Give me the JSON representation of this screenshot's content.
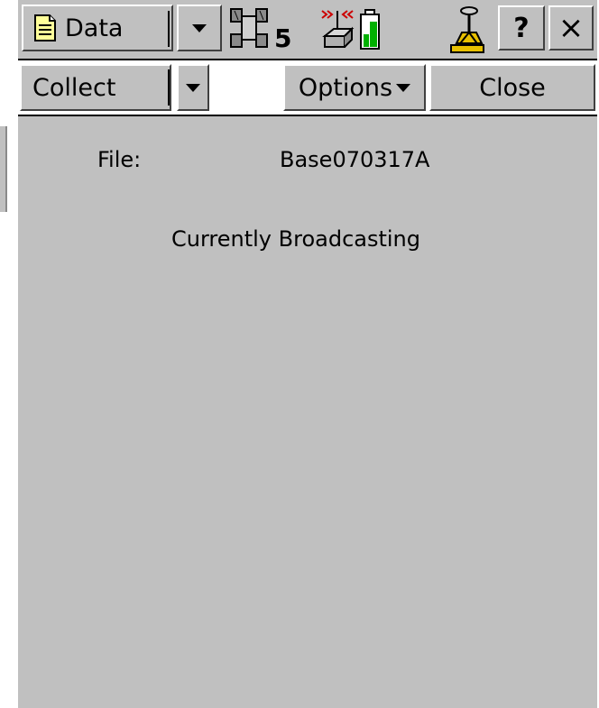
{
  "toolbar": {
    "data_menu_label": "Data",
    "satellite_count": "5",
    "help_label": "?",
    "close_label": "×"
  },
  "menubar": {
    "collect_label": "Collect",
    "options_label": "Options",
    "close_label": "Close"
  },
  "content": {
    "file_label": "File:",
    "file_value": "Base070317A",
    "status": "Currently Broadcasting"
  }
}
